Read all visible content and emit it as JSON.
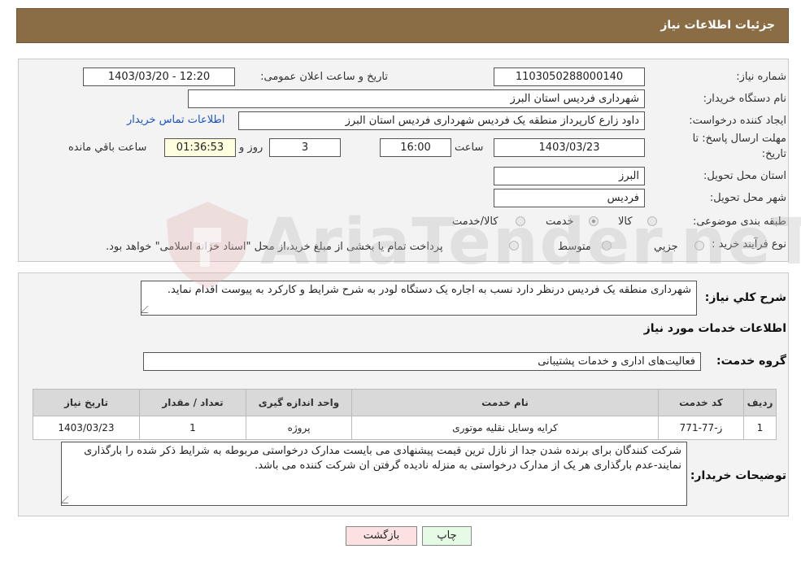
{
  "header": {
    "title": "جزئیات اطلاعات نیاز"
  },
  "details": {
    "need_number_label": "شماره نیاز:",
    "need_number": "1103050288000140",
    "announce_label": "تاریخ و ساعت اعلان عمومی:",
    "announce_value": "1403/03/20 - 12:20",
    "buyer_org_label": "نام دستگاه خریدار:",
    "buyer_org": "شهرداری فردیس استان البرز",
    "creator_label": "ایجاد کننده درخواست:",
    "creator": "داود زارع کارپرداز منطقه یک فردیس شهرداری فردیس استان البرز",
    "contact_link": "اطلاعات تماس خریدار",
    "deadline_label_1": "مهلت ارسال پاسخ: تا",
    "deadline_label_2": "تاریخ:",
    "deadline_date": "1403/03/23",
    "time_label": "ساعت",
    "deadline_time": "16:00",
    "days_value": "3",
    "days_label": "روز و",
    "remaining_time": "01:36:53",
    "remaining_label": "ساعت باقي مانده",
    "province_label": "استان محل تحویل:",
    "province": "البرز",
    "city_label": "شهر محل تحویل:",
    "city": "فردیس",
    "category_label": "طبقه بندی موضوعی:",
    "category_options": [
      "کالا",
      "خدمت",
      "کالا/خدمت"
    ],
    "category_selected": "خدمت",
    "process_label": "نوع فرآیند خرید :",
    "process_options": [
      "جزیي",
      "متوسط"
    ],
    "process_note": "پرداخت تمام یا بخشی از مبلغ خرید،از محل \"اسناد خزانه اسلامی\" خواهد بود."
  },
  "general": {
    "description_label": "شرح کلي نیاز:",
    "description": "شهرداری منطقه یک فردیس درنظر دارد نسب  به اجاره یک دستگاه لودر به شرح شرایط و کارکرد به پیوست اقدام نماید.",
    "services_heading": "اطلاعات خدمات مورد نیاز",
    "service_group_label": "گروه خدمت:",
    "service_group": "فعالیت‌های اداری و خدمات پشتیبانی"
  },
  "table": {
    "headers": [
      "ردیف",
      "کد خدمت",
      "نام خدمت",
      "واحد اندازه گیری",
      "تعداد / مقدار",
      "تاریخ نیاز"
    ],
    "rows": [
      [
        "1",
        "ز-77-771",
        "کرایه وسایل نقلیه موتوری",
        "پروژه",
        "1",
        "1403/03/23"
      ]
    ]
  },
  "buyer_notes": {
    "label": "توضیحات خریدار:",
    "text": "شرکت کنندگان برای برنده شدن جدا از نازل ترین قیمت پیشنهادی می بایست مدارک درخواستی مربوطه به شرایط ذکر شده را بارگذاری نمایند-عدم بارگذاری هر یک از مدارک درخواستی به منزله نادیده گرفتن ان شرکت کننده می باشد."
  },
  "buttons": {
    "print": "چاپ",
    "back": "بازگشت"
  },
  "watermark": "AriaTender.neT",
  "colors": {
    "header_bg": "#8b6d45",
    "link": "#1a55c4",
    "back_button_bg": "#fbe1e1",
    "print_button_bg": "#e6fbe6"
  }
}
